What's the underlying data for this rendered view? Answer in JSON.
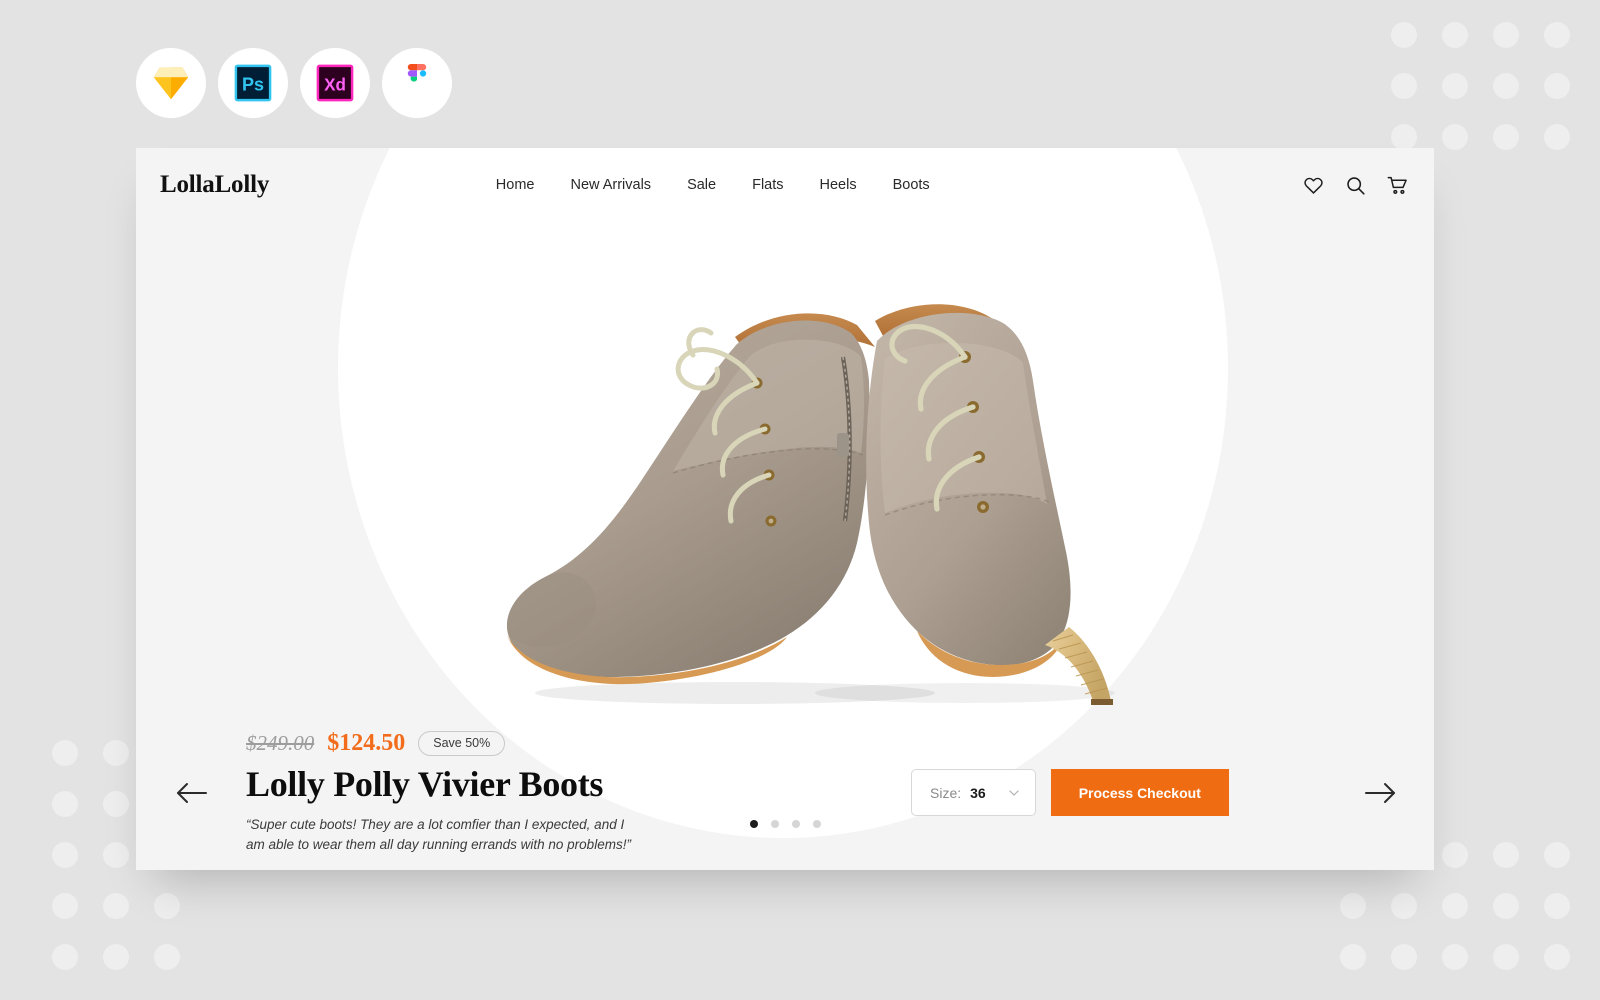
{
  "tools": [
    {
      "name": "sketch",
      "label": "Sketch"
    },
    {
      "name": "photoshop",
      "label": "Ps"
    },
    {
      "name": "adobe-xd",
      "label": "Xd"
    },
    {
      "name": "figma",
      "label": "Figma"
    }
  ],
  "header": {
    "brand": "LollaLolly",
    "nav": [
      {
        "label": "Home"
      },
      {
        "label": "New Arrivals"
      },
      {
        "label": "Sale"
      },
      {
        "label": "Flats"
      },
      {
        "label": "Heels"
      },
      {
        "label": "Boots"
      }
    ],
    "actions": [
      {
        "icon": "heart-icon"
      },
      {
        "icon": "search-icon"
      },
      {
        "icon": "cart-icon"
      }
    ]
  },
  "carousel": {
    "dot_count": 4,
    "active_index": 0,
    "prev_icon": "arrow-left-icon",
    "next_icon": "arrow-right-icon"
  },
  "product": {
    "price_old": "$249.00",
    "price_new": "$124.50",
    "save_badge": "Save 50%",
    "title": "Lolly Polly Vivier Boots",
    "quote": "“Super cute boots! They are a lot comfier than I expected, and I am able to wear them all day running errands with no problems!”",
    "size_label": "Size:",
    "size_value": "36",
    "checkout_label": "Process Checkout"
  },
  "colors": {
    "accent": "#ef6c12",
    "price_sale": "#f26c1b",
    "card_bg": "#f4f4f4",
    "page_bg": "#e3e3e3",
    "hero_bg": "#ffffff"
  }
}
